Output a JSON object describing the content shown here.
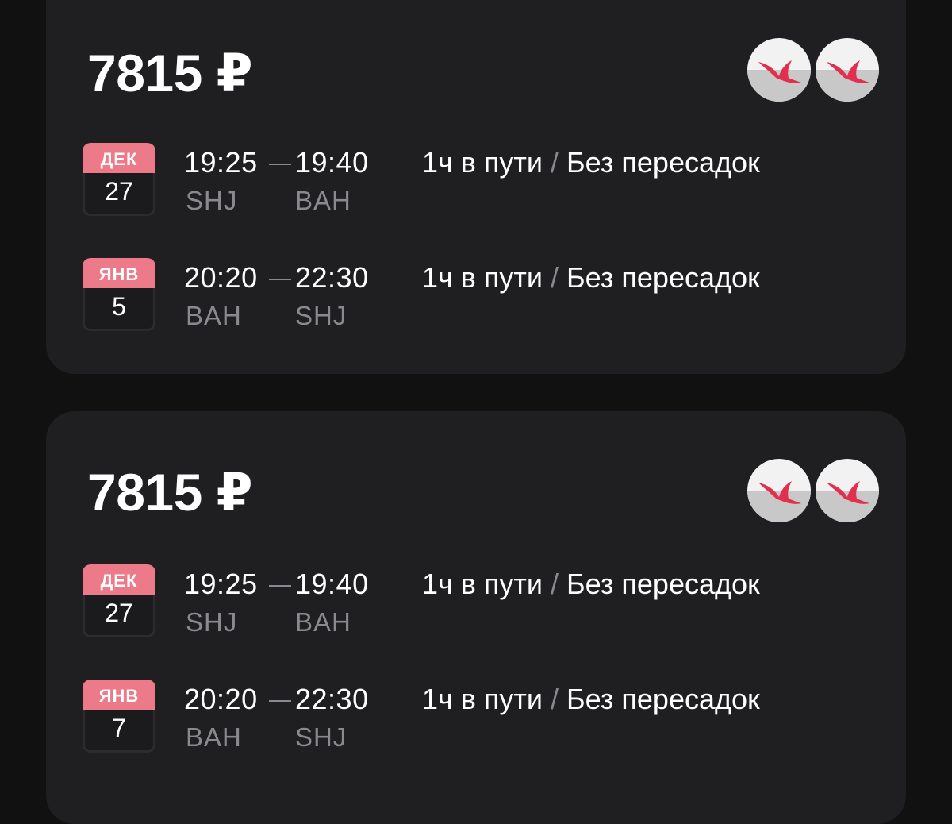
{
  "cards": [
    {
      "price": "7815 ₽",
      "airline_logos": [
        "gull-logo-icon",
        "gull-logo-icon"
      ],
      "segments": [
        {
          "month": "ДЕК",
          "day": "27",
          "dep_time": "19:25",
          "arr_time": "19:40",
          "dep_code": "SHJ",
          "arr_code": "BAH",
          "duration": "1ч в пути",
          "separator": "/",
          "stops": "Без пересадок"
        },
        {
          "month": "ЯНВ",
          "day": "5",
          "dep_time": "20:20",
          "arr_time": "22:30",
          "dep_code": "BAH",
          "arr_code": "SHJ",
          "duration": "1ч в пути",
          "separator": "/",
          "stops": "Без пересадок"
        }
      ]
    },
    {
      "price": "7815 ₽",
      "airline_logos": [
        "gull-logo-icon",
        "gull-logo-icon"
      ],
      "segments": [
        {
          "month": "ДЕК",
          "day": "27",
          "dep_time": "19:25",
          "arr_time": "19:40",
          "dep_code": "SHJ",
          "arr_code": "BAH",
          "duration": "1ч в пути",
          "separator": "/",
          "stops": "Без пересадок"
        },
        {
          "month": "ЯНВ",
          "day": "7",
          "dep_time": "20:20",
          "arr_time": "22:30",
          "dep_code": "BAH",
          "arr_code": "SHJ",
          "duration": "1ч в пути",
          "separator": "/",
          "stops": "Без пересадок"
        }
      ]
    }
  ],
  "colors": {
    "background": "#111112",
    "card": "#1f1f21",
    "calendar_month": "#ed7a88",
    "logo_bird": "#e0304e",
    "muted_text": "#8a8a8e"
  }
}
